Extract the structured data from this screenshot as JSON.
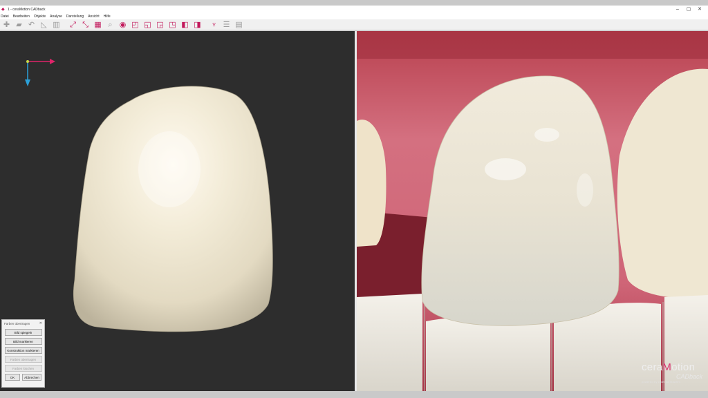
{
  "window": {
    "title": "1 - ceraMotion CADback",
    "controls": [
      "–",
      "▢",
      "✕"
    ]
  },
  "menu": [
    "Datei",
    "Bearbeiten",
    "Objekte",
    "Analyse",
    "Darstellung",
    "Ansicht",
    "Hilfe"
  ],
  "toolbar": {
    "icons": [
      "add-icon",
      "folder-icon",
      "undo-icon",
      "measure-icon",
      "trash-icon",
      "fit-view-icon",
      "collapse-view-icon",
      "grid-icon",
      "search-icon",
      "camera-icon",
      "cube-front-icon",
      "cube-back-icon",
      "cube-left-icon",
      "cube-right-icon",
      "cube-top-icon",
      "cube-bottom-icon",
      "tooth-icon",
      "layers-icon",
      "scanner-icon"
    ]
  },
  "dialog": {
    "title": "Farben übertragen",
    "close": "✕",
    "buttons": [
      {
        "label": "Bild spiegeln",
        "enabled": true
      },
      {
        "label": "Bild markieren",
        "enabled": true
      },
      {
        "label": "Konstruktion markieren",
        "enabled": true
      },
      {
        "label": "Farben übertragen",
        "enabled": false
      },
      {
        "label": "Farben löschen",
        "enabled": false
      }
    ],
    "ok": "OK",
    "cancel": "Abbrechen"
  },
  "logo": {
    "text_a": "cera",
    "text_m": "M",
    "text_b": "otion",
    "sub": "CADback",
    "powered": "powered by c dei da mazzini"
  },
  "axes": {
    "x_color": "#e0246a",
    "y_color": "#2ba0d8",
    "origin_color": "#c8d94a"
  },
  "colors": {
    "accent": "#c2185b",
    "viewport_bg": "#2d2d2d",
    "tooth": "#efe8d4"
  }
}
